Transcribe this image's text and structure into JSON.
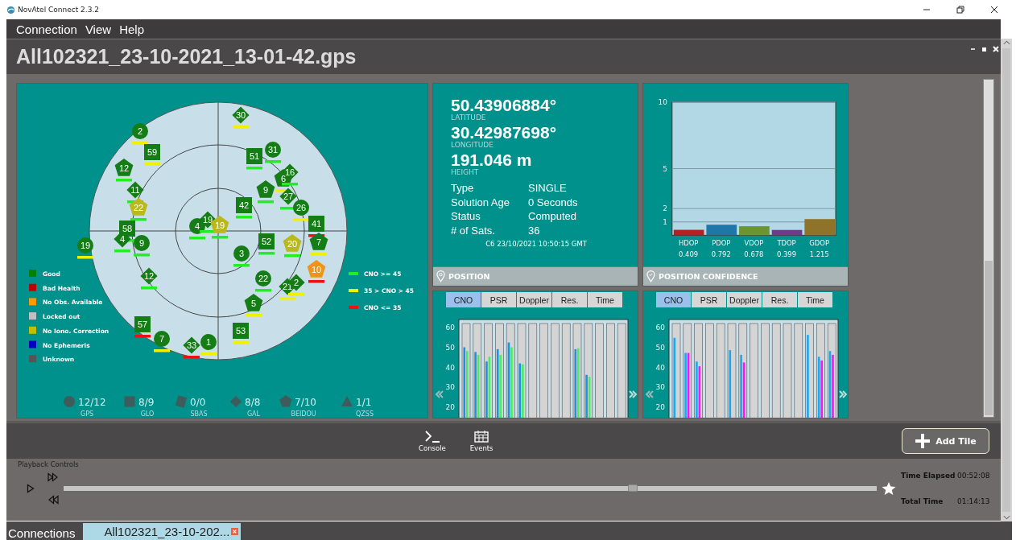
{
  "window": {
    "title": "NovAtel Connect 2.3.2"
  },
  "menu": [
    "Connection",
    "View",
    "Help"
  ],
  "document": {
    "title": "All102321_23-10-2021_13-01-42.gps"
  },
  "sky": {
    "satellites": [
      {
        "prn": "30",
        "kind": "gal",
        "color": "#157d15",
        "cno_bar": {
          "color": "#f0f000"
        }
      },
      {
        "prn": "2",
        "kind": "gps",
        "color": "#157d15",
        "cno_bar": {
          "color": "#f0f000"
        }
      },
      {
        "prn": "59",
        "kind": "glo",
        "color": "#157d15",
        "cno_bar": {
          "color": "#f0f000"
        }
      },
      {
        "prn": "51",
        "kind": "glo",
        "color": "#157d15",
        "cno_bar": {
          "color": "#22ee22"
        }
      },
      {
        "prn": "31",
        "kind": "gps",
        "color": "#157d15",
        "cno_bar": {
          "color": "#22ee22"
        }
      },
      {
        "prn": "12",
        "kind": "beidou",
        "color": "#157d15",
        "cno_bar": {
          "color": "#22ee22"
        }
      },
      {
        "prn": "6",
        "kind": "beidou",
        "color": "#157d15",
        "cno_bar": {
          "color": "#f0f000"
        }
      },
      {
        "prn": "16",
        "kind": "gal",
        "color": "#157d15",
        "cno_bar": {
          "color": "#22ee22"
        }
      },
      {
        "prn": "11",
        "kind": "gal",
        "color": "#157d15",
        "cno_bar": {
          "color": "#22ee22"
        }
      },
      {
        "prn": "9",
        "kind": "beidou",
        "color": "#157d15",
        "cno_bar": {
          "color": "#22ee22"
        }
      },
      {
        "prn": "27",
        "kind": "gal",
        "color": "#157d15",
        "cno_bar": {
          "color": "#22ee22"
        }
      },
      {
        "prn": "22",
        "kind": "beidou",
        "color": "#b9b91c",
        "cno_bar": {
          "color": "#22ee22"
        }
      },
      {
        "prn": "42",
        "kind": "glo",
        "color": "#157d15",
        "cno_bar": {
          "color": "#22ee22"
        }
      },
      {
        "prn": "26",
        "kind": "gps",
        "color": "#157d15",
        "cno_bar": {
          "color": "#f0f000"
        }
      },
      {
        "prn": "58",
        "kind": "glo",
        "color": "#157d15",
        "cno_bar": {
          "color": "#22ee22"
        }
      },
      {
        "prn": "4",
        "kind": "gps",
        "color": "#157d15",
        "cno_bar": {
          "color": "#22ee22"
        }
      },
      {
        "prn": "19",
        "kind": "gal",
        "color": "#157d15",
        "cno_bar": {
          "color": "#22ee22"
        }
      },
      {
        "prn": "19",
        "kind": "beidou",
        "color": "#b9b91c",
        "cno_bar": {
          "color": "#22ee22"
        }
      },
      {
        "prn": "41",
        "kind": "glo",
        "color": "#157d15",
        "cno_bar": {
          "color": "#ee1111"
        }
      },
      {
        "prn": "19",
        "kind": "gps",
        "color": "#157d15",
        "cno_bar": {
          "color": "#f0f000"
        }
      },
      {
        "prn": "4",
        "kind": "gal",
        "color": "#157d15",
        "cno_bar": {
          "color": "#22ee22"
        }
      },
      {
        "prn": "9",
        "kind": "gps",
        "color": "#157d15",
        "cno_bar": {
          "color": "#22ee22"
        }
      },
      {
        "prn": "52",
        "kind": "glo",
        "color": "#157d15",
        "cno_bar": {
          "color": "#22ee22"
        }
      },
      {
        "prn": "20",
        "kind": "beidou",
        "color": "#b9b91c",
        "cno_bar": {
          "color": "#22ee22"
        }
      },
      {
        "prn": "7",
        "kind": "beidou",
        "color": "#157d15",
        "cno_bar": {
          "color": "#f0f000"
        }
      },
      {
        "prn": "3",
        "kind": "gps",
        "color": "#157d15",
        "cno_bar": {
          "color": "#22ee22"
        }
      },
      {
        "prn": "12",
        "kind": "gal",
        "color": "#157d15",
        "cno_bar": {
          "color": "#22ee22"
        }
      },
      {
        "prn": "22",
        "kind": "gps",
        "color": "#157d15",
        "cno_bar": {
          "color": "#22ee22"
        }
      },
      {
        "prn": "21",
        "kind": "gal",
        "color": "#157d15",
        "cno_bar": {
          "color": "#f0f000"
        }
      },
      {
        "prn": "2",
        "kind": "gal",
        "color": "#157d15",
        "cno_bar": {
          "color": "#f0f000"
        }
      },
      {
        "prn": "10",
        "kind": "beidou",
        "color": "#f09418",
        "cno_bar": {
          "color": "#ee1111"
        }
      },
      {
        "prn": "5",
        "kind": "beidou",
        "color": "#157d15",
        "cno_bar": {
          "color": "#f0f000"
        }
      },
      {
        "prn": "57",
        "kind": "glo",
        "color": "#157d15",
        "cno_bar": {
          "color": "#ee1111"
        }
      },
      {
        "prn": "7",
        "kind": "gps",
        "color": "#157d15",
        "cno_bar": {
          "color": "#f0f000"
        }
      },
      {
        "prn": "33",
        "kind": "gal",
        "color": "#157d15",
        "cno_bar": {
          "color": "#ee1111"
        }
      },
      {
        "prn": "1",
        "kind": "gps",
        "color": "#157d15",
        "cno_bar": {
          "color": "#f0f000"
        }
      },
      {
        "prn": "53",
        "kind": "glo",
        "color": "#157d15",
        "cno_bar": {
          "color": "#f0f000"
        }
      }
    ],
    "health_legend": [
      {
        "label": "Good",
        "color": "#008000"
      },
      {
        "label": "Bad Health",
        "color": "#c00000"
      },
      {
        "label": "No Obs. Available",
        "color": "#ff9900"
      },
      {
        "label": "Locked out",
        "color": "#c0c0c0"
      },
      {
        "label": "No Iono. Correction",
        "color": "#c0c000"
      },
      {
        "label": "No Ephemeris",
        "color": "#0000c0"
      },
      {
        "label": "Unknown",
        "color": "#555555"
      }
    ],
    "cno_legend": [
      {
        "label": "CNO >= 45",
        "color": "#22ee22"
      },
      {
        "label": "35 > CNO > 45",
        "color": "#f0f000"
      },
      {
        "label": "CNO <= 35",
        "color": "#ee1111"
      }
    ],
    "constellations": [
      {
        "kind": "gps",
        "count": "12/12",
        "name": "GPS"
      },
      {
        "kind": "glo",
        "count": "8/9",
        "name": "GLO"
      },
      {
        "kind": "sbas",
        "count": "0/0",
        "name": "SBAS"
      },
      {
        "kind": "gal",
        "count": "8/8",
        "name": "GAL"
      },
      {
        "kind": "beidou",
        "count": "7/10",
        "name": "BEIDOU"
      },
      {
        "kind": "qzss",
        "count": "1/1",
        "name": "QZSS"
      }
    ]
  },
  "position": {
    "fields": [
      {
        "value": "50.43906884°",
        "label": "LATITUDE"
      },
      {
        "value": "30.42987698°",
        "label": "LONGITUDE"
      },
      {
        "value": "191.046 m",
        "label": "HEIGHT"
      }
    ],
    "details": [
      {
        "label": "Type",
        "value": "SINGLE"
      },
      {
        "label": "Solution Age",
        "value": "0 Seconds"
      },
      {
        "label": "Status",
        "value": "Computed"
      },
      {
        "label": "# of Sats.",
        "value": "36"
      }
    ],
    "timestamp": "C6 23/10/2021 10:50:15 GMT",
    "header": "POSITION"
  },
  "position_confidence": {
    "header": "POSITION CONFIDENCE",
    "value_labels": [
      "0.409",
      "0.792",
      "0.678",
      "0.399",
      "1.215"
    ],
    "bars": [
      {
        "color": "#b22222"
      },
      {
        "color": "#1f77a8"
      },
      {
        "color": "#6b9530"
      },
      {
        "color": "#6e3a8e"
      },
      {
        "color": "#8e7328"
      }
    ],
    "chart_data": {
      "type": "bar",
      "categories": [
        "HDOP",
        "PDOP",
        "VDOP",
        "TDOP",
        "GDOP"
      ],
      "values": [
        0.409,
        0.792,
        0.678,
        0.399,
        1.215
      ],
      "ylim": [
        0,
        10
      ],
      "yticks": [
        1,
        2,
        5,
        10
      ],
      "grid": true
    }
  },
  "signal_tiles": [
    {
      "tabs": [
        {
          "label": "CNO",
          "selected": true
        },
        {
          "label": "PSR",
          "selected": false
        },
        {
          "label": "Doppler",
          "selected": false
        },
        {
          "label": "Res.",
          "selected": false
        },
        {
          "label": "Time",
          "selected": false
        }
      ],
      "y_labels": [
        "60",
        "50",
        "40",
        "30",
        "20"
      ],
      "slots": [
        {
          "bars": [
            {
              "level": 0.75,
              "color": "#1e90e0"
            },
            {
              "level": 0.71,
              "color": "#44ee66"
            }
          ]
        },
        {
          "bars": [
            {
              "level": 0.7,
              "color": "#1e90e0"
            },
            {
              "level": 0.67,
              "color": "#44ee66"
            }
          ]
        },
        {
          "bars": [
            {
              "level": 0.6,
              "color": "#1e90e0"
            },
            {
              "level": 0.65,
              "color": "#44ee66"
            }
          ]
        },
        {
          "bars": [
            {
              "level": 0.73,
              "color": "#1e90e0"
            },
            {
              "level": 0.67,
              "color": "#44ee66"
            }
          ]
        },
        {
          "bars": [
            {
              "level": 0.8,
              "color": "#1e90e0"
            },
            {
              "level": 0.75,
              "color": "#44ee66"
            }
          ]
        },
        {
          "bars": [
            {
              "level": 0.58,
              "color": "#1e90e0"
            },
            {
              "level": 0.57,
              "color": "#44ee66"
            }
          ]
        },
        {
          "kind": "empty"
        },
        {
          "kind": "empty"
        },
        {
          "kind": "empty"
        },
        {
          "kind": "empty"
        },
        {
          "bars": [
            {
              "level": 0.73,
              "color": "#1e90e0"
            },
            {
              "level": 0.74,
              "color": "#44ee66"
            }
          ]
        },
        {
          "bars": [
            {
              "level": 0.46,
              "color": "#1e90e0"
            },
            {
              "level": 0.44,
              "color": "#44ee66"
            }
          ]
        },
        {
          "kind": "empty"
        },
        {
          "kind": "empty"
        },
        {
          "kind": "empty"
        }
      ]
    },
    {
      "tabs": [
        {
          "label": "CNO",
          "selected": true
        },
        {
          "label": "PSR",
          "selected": false
        },
        {
          "label": "Doppler",
          "selected": false
        },
        {
          "label": "Res.",
          "selected": false
        },
        {
          "label": "Time",
          "selected": false
        }
      ],
      "y_labels": [
        "60",
        "50",
        "40",
        "30",
        "20"
      ],
      "slots": [
        {
          "bars": [
            {
              "level": 0.85,
              "color": "#1aa8f0"
            }
          ]
        },
        {
          "bars": [
            {
              "level": 0.69,
              "color": "#1aa8f0"
            },
            {
              "level": 0.69,
              "color": "#ff10ff"
            }
          ]
        },
        {
          "bars": [
            {
              "level": 0.6,
              "color": "#1aa8f0"
            },
            {
              "level": 0.55,
              "color": "#ff10ff"
            }
          ]
        },
        {
          "kind": "empty"
        },
        {
          "kind": "empty"
        },
        {
          "bars": [
            {
              "level": 0.72,
              "color": "#1aa8f0"
            }
          ]
        },
        {
          "bars": [
            {
              "level": 0.67,
              "color": "#1aa8f0"
            },
            {
              "level": 0.59,
              "color": "#ff10ff"
            }
          ]
        },
        {
          "kind": "empty"
        },
        {
          "kind": "empty"
        },
        {
          "kind": "empty"
        },
        {
          "kind": "empty"
        },
        {
          "kind": "empty"
        },
        {
          "bars": [
            {
              "level": 0.88,
              "color": "#1aa8f0"
            }
          ]
        },
        {
          "bars": [
            {
              "level": 0.65,
              "color": "#1aa8f0"
            },
            {
              "level": 0.61,
              "color": "#ff10ff"
            }
          ]
        },
        {
          "bars": [
            {
              "level": 0.71,
              "color": "#1aa8f0"
            },
            {
              "level": 0.67,
              "color": "#ff10ff"
            }
          ]
        }
      ]
    }
  ],
  "toolbar": {
    "items": [
      {
        "kind": "console",
        "label": "Console"
      },
      {
        "kind": "events",
        "label": "Events"
      }
    ],
    "add_button": "Add Tile"
  },
  "playback": {
    "title": "Playback Controls",
    "level": 0.7,
    "times": [
      {
        "label": "Time Elapsed",
        "value": "00:52:08"
      },
      {
        "label": "Total Time",
        "value": "01:14:13"
      }
    ]
  },
  "bottom_tabs": {
    "label": "Connections",
    "tabs": [
      {
        "label": "All102321_23-10-202...",
        "selected": true
      }
    ]
  }
}
